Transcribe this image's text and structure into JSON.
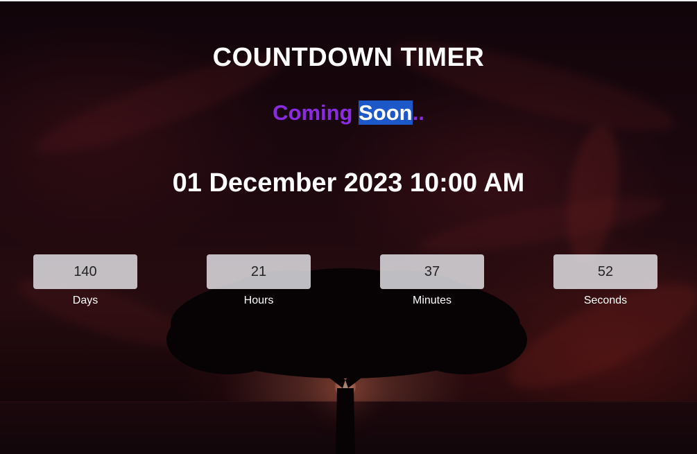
{
  "header": {
    "title": "COUNTDOWN TIMER"
  },
  "subtitle": {
    "coming": "Coming ",
    "selected": "Soon",
    "dots": ".."
  },
  "target_date": "01 December 2023 10:00 AM",
  "timer": [
    {
      "value": "140",
      "label": "Days"
    },
    {
      "value": "21",
      "label": "Hours"
    },
    {
      "value": "37",
      "label": "Minutes"
    },
    {
      "value": "52",
      "label": "Seconds"
    }
  ],
  "colors": {
    "accent": "#8a2be2",
    "selection": "#1c58c8",
    "box_bg": "#e6e6eb"
  }
}
